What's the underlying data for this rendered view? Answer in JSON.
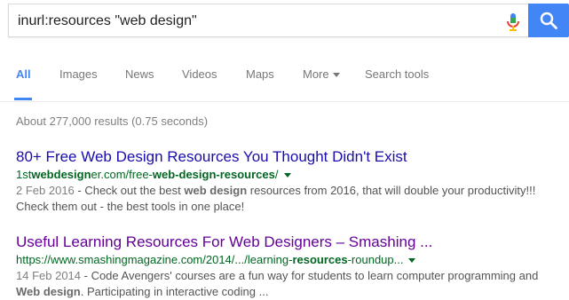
{
  "search": {
    "query": "inurl:resources \"web design\""
  },
  "colors": {
    "accent": "#4285f4",
    "link": "#1a0dab",
    "visited": "#609",
    "url": "#006621"
  },
  "tabs": [
    {
      "label": "All",
      "active": true
    },
    {
      "label": "Images"
    },
    {
      "label": "News"
    },
    {
      "label": "Videos"
    },
    {
      "label": "Maps"
    },
    {
      "label": "More"
    },
    {
      "label": "Search tools"
    }
  ],
  "stats": "About 277,000 results (0.75 seconds)",
  "results": [
    {
      "title": "80+ Free Web Design Resources You Thought Didn't Exist",
      "url_parts": [
        "1st",
        "webdesign",
        "er.com/free-",
        "web-design-resources",
        "/"
      ],
      "date": "2 Feb 2016",
      "snippet_parts": [
        " - Check out the best ",
        "web design",
        " resources from 2016, that will double your productivity!!! Check them out - the best tools in one place!"
      ]
    },
    {
      "title": "Useful Learning Resources For Web Designers – Smashing ...",
      "url_parts": [
        "https://www.smashingmagazine.com/2014/.../learning-",
        "resources",
        "-roundup..."
      ],
      "date": "14 Feb 2014",
      "snippet_parts": [
        " - Code Avengers' courses are a fun way for students to learn computer programming and ",
        "Web design",
        ". Participating in interactive coding ..."
      ]
    }
  ]
}
